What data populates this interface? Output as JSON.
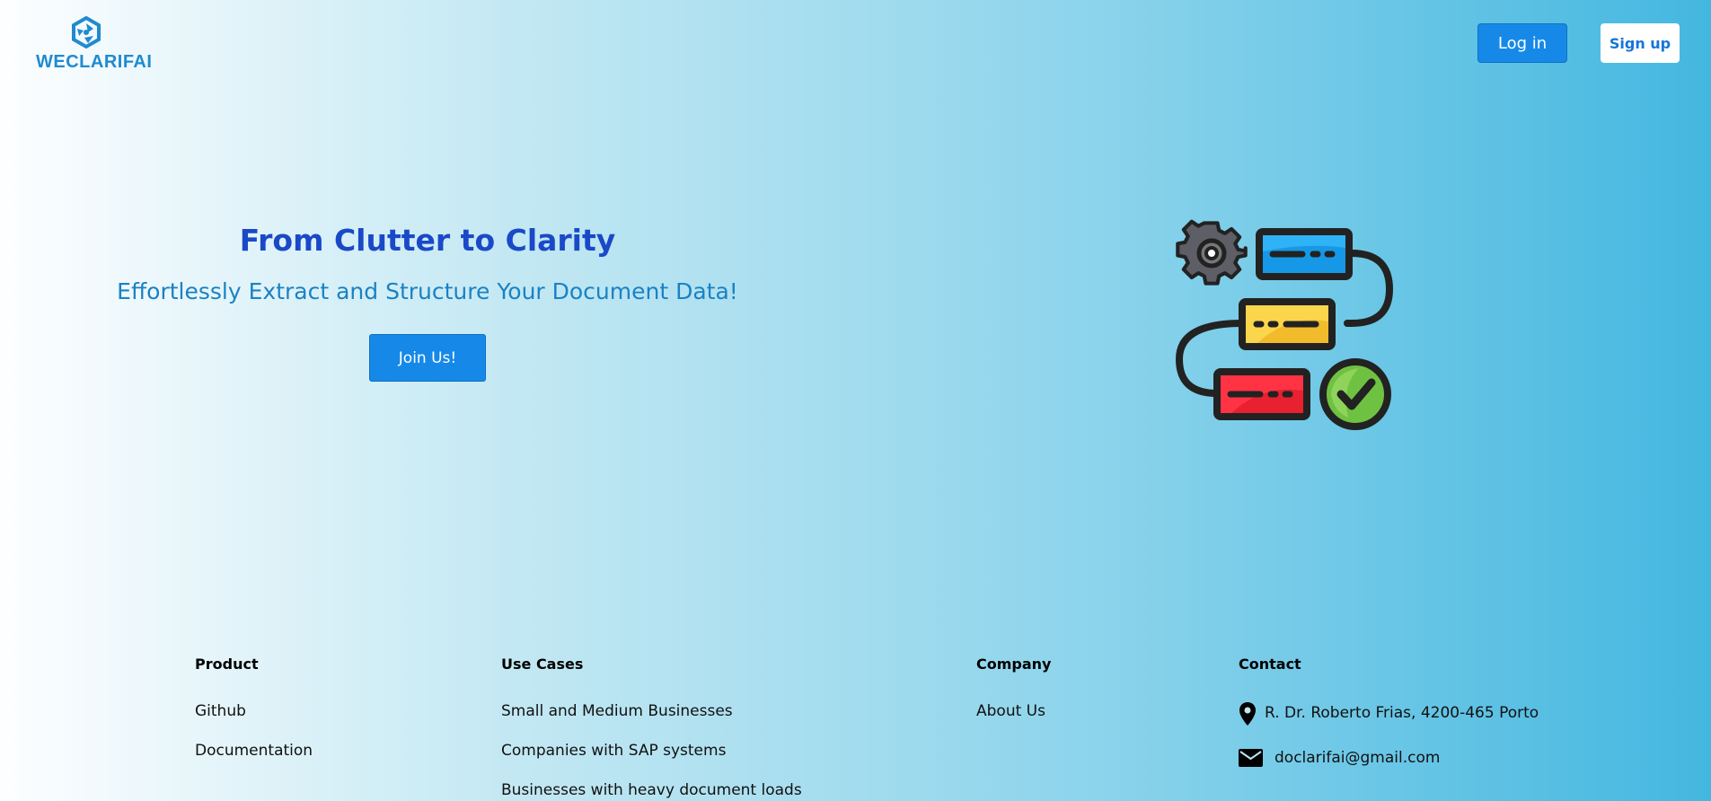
{
  "header": {
    "logo_text": "WECLARIFAI",
    "login_label": "Log in",
    "signup_label": "Sign up"
  },
  "hero": {
    "title": "From Clutter to Clarity",
    "subtitle": "Effortlessly Extract and Structure Your Document Data!",
    "cta_label": "Join Us!"
  },
  "footer": {
    "product": {
      "heading": "Product",
      "links": [
        "Github",
        "Documentation"
      ]
    },
    "use_cases": {
      "heading": "Use Cases",
      "links": [
        "Small and Medium Businesses",
        "Companies with SAP systems",
        "Businesses with heavy document loads"
      ]
    },
    "company": {
      "heading": "Company",
      "links": [
        "About Us"
      ]
    },
    "contact": {
      "heading": "Contact",
      "address": "R. Dr. Roberto Frias, 4200-465 Porto",
      "email": "doclarifai@gmail.com"
    }
  },
  "icons": {
    "logo": "hexagon-logo-icon",
    "illustration": "workflow-pipeline-icon",
    "address": "map-pin-icon",
    "email": "envelope-icon"
  },
  "colors": {
    "primary_button": "#1689e8",
    "title": "#1a49c8",
    "subtitle": "#1a82c4",
    "logo": "#1f8bcf"
  }
}
